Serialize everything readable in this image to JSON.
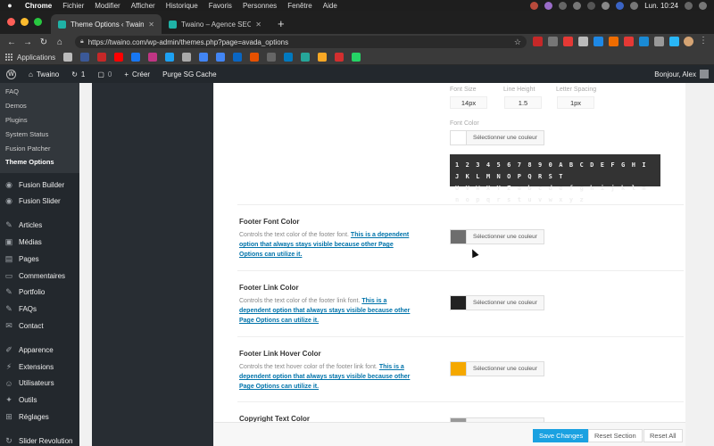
{
  "menubar": {
    "items": [
      "Chrome",
      "Fichier",
      "Modifier",
      "Afficher",
      "Historique",
      "Favoris",
      "Personnes",
      "Fenêtre",
      "Aide"
    ],
    "clock": "Lun. 10:24"
  },
  "tabs": [
    {
      "title": "Theme Options ‹ Twaino — W"
    },
    {
      "title": "Twaino – Agence SEO"
    }
  ],
  "address": {
    "url": "https://twaino.com/wp-admin/themes.php?page=avada_options"
  },
  "bookmarks": {
    "apps_label": "Applications"
  },
  "adminbar": {
    "site": "Twaino",
    "updates": "1",
    "comments": "0",
    "new": "Créer",
    "purge": "Purge SG Cache",
    "greeting": "Bonjour, Alex"
  },
  "sidebar": {
    "sub_items": [
      {
        "label": "FAQ"
      },
      {
        "label": "Demos"
      },
      {
        "label": "Plugins"
      },
      {
        "label": "System Status"
      },
      {
        "label": "Fusion Patcher"
      },
      {
        "label": "Theme Options"
      }
    ],
    "groups": [
      [
        {
          "label": "Fusion Builder",
          "icon": "fusion-icon"
        },
        {
          "label": "Fusion Slider",
          "icon": "fusion-icon"
        }
      ],
      [
        {
          "label": "Articles",
          "icon": "pin-icon"
        },
        {
          "label": "Médias",
          "icon": "media-icon"
        },
        {
          "label": "Pages",
          "icon": "page-icon"
        },
        {
          "label": "Commentaires",
          "icon": "comment-icon"
        },
        {
          "label": "Portfolio",
          "icon": "pin-icon"
        },
        {
          "label": "FAQs",
          "icon": "pin-icon"
        },
        {
          "label": "Contact",
          "icon": "mail-icon"
        }
      ],
      [
        {
          "label": "Apparence",
          "icon": "brush-icon"
        },
        {
          "label": "Extensions",
          "icon": "plugin-icon"
        },
        {
          "label": "Utilisateurs",
          "icon": "users-icon"
        },
        {
          "label": "Outils",
          "icon": "tools-icon"
        },
        {
          "label": "Réglages",
          "icon": "settings-icon"
        }
      ],
      [
        {
          "label": "Slider Revolution",
          "icon": "slider-icon"
        }
      ]
    ]
  },
  "typography": {
    "font_size_label": "Font Size",
    "line_height_label": "Line Height",
    "letter_spacing_label": "Letter Spacing",
    "font_size": "14px",
    "line_height": "1.5",
    "letter_spacing": "1px",
    "font_color_label": "Font Color",
    "preview_line1": "1 2 3 4 5 6 7 8 9 0 A B C D E F G H I J K L M N O P Q R S T",
    "preview_line2": "U V W X Y Z a b c d e f g h i j k l m n o p q r s t u v w x y z"
  },
  "options": [
    {
      "title": "Footer Font Color",
      "desc": "Controls the text color of the footer font.",
      "link": "This is a dependent option that always stays visible because other Page Options can utilize it.",
      "color": "#6e6e6e"
    },
    {
      "title": "Footer Link Color",
      "desc": "Controls the text color of the footer link font.",
      "link": "This is a dependent option that always stays visible because other Page Options can utilize it.",
      "color": "#222222"
    },
    {
      "title": "Footer Link Hover Color",
      "desc": "Controls the text hover color of the footer link font.",
      "link": "This is a dependent option that always stays visible because other Page Options can utilize it.",
      "color": "#f5a800"
    },
    {
      "title": "Copyright Text Color",
      "color": "#999999"
    }
  ],
  "color_button_label": "Sélectionner une couleur",
  "footer": {
    "save": "Save Changes",
    "reset_section": "Reset Section",
    "reset_all": "Reset All"
  },
  "colors": {
    "accent": "#1aa1e1",
    "link": "#0073aa",
    "admin_dark": "#23282d"
  }
}
